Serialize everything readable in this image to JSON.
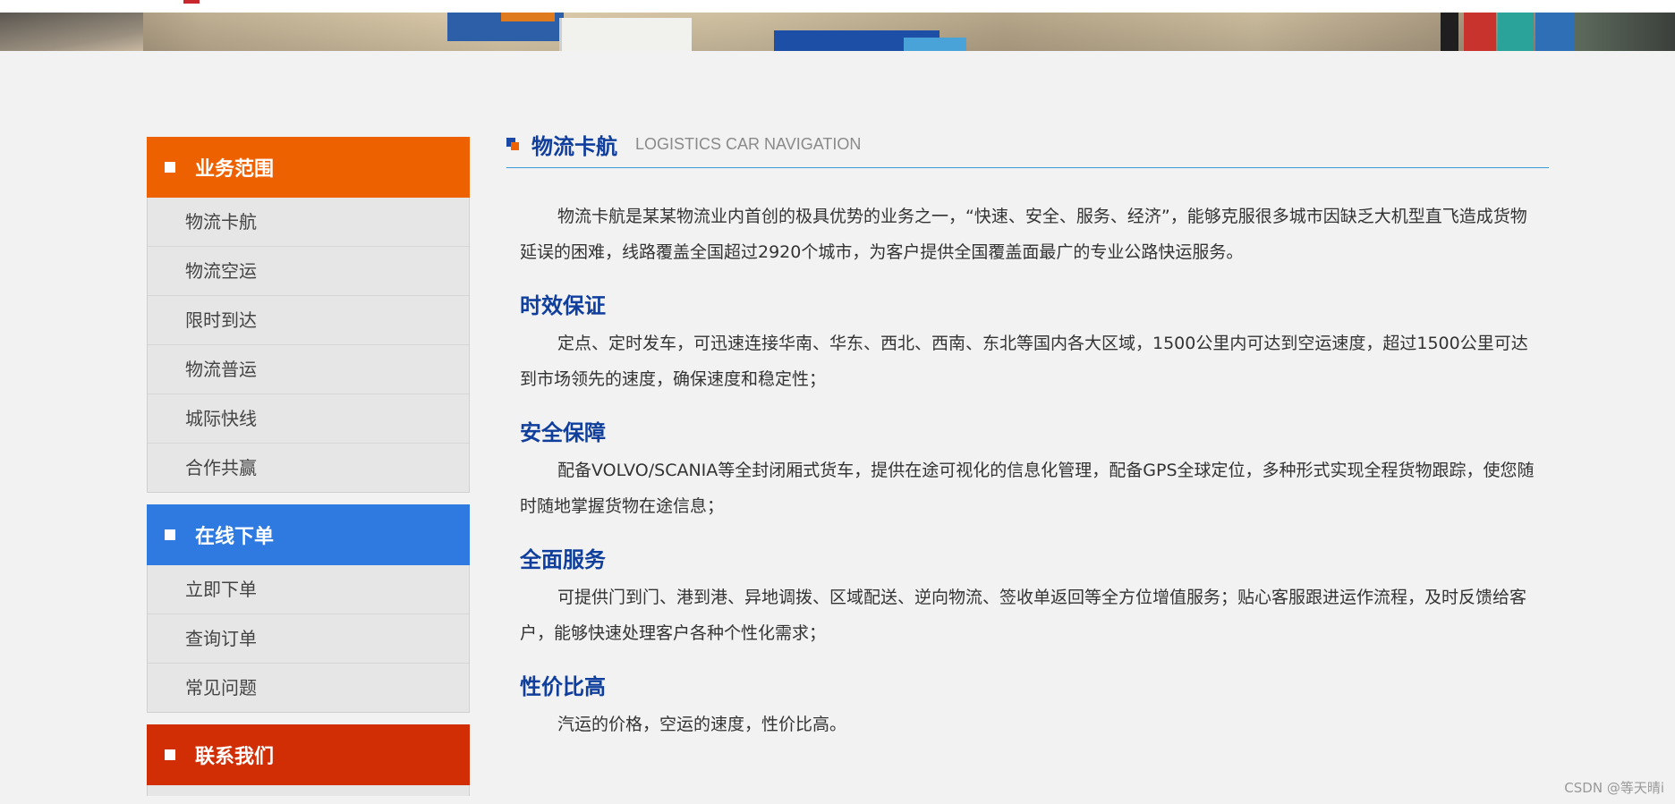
{
  "sidebar": {
    "groups": [
      {
        "title": "业务范围",
        "items": [
          "物流卡航",
          "物流空运",
          "限时到达",
          "物流普运",
          "城际快线",
          "合作共赢"
        ]
      },
      {
        "title": "在线下单",
        "items": [
          "立即下单",
          "查询订单",
          "常见问题"
        ]
      },
      {
        "title": "联系我们",
        "items": []
      }
    ]
  },
  "main": {
    "title_cn": "物流卡航",
    "title_en": "LOGISTICS CAR NAVIGATION",
    "intro": "物流卡航是某某物流业内首创的极具优势的业务之一，“快速、安全、服务、经济”，能够克服很多城市因缺乏大机型直飞造成货物延误的困难，线路覆盖全国超过2920个城市，为客户提供全国覆盖面最广的专业公路快运服务。",
    "sections": [
      {
        "title": "时效保证",
        "text": "定点、定时发车，可迅速连接华南、华东、西北、西南、东北等国内各大区域，1500公里内可达到空运速度，超过1500公里可达到市场领先的速度，确保速度和稳定性；"
      },
      {
        "title": "安全保障",
        "text": "配备VOLVO/SCANIA等全封闭厢式货车，提供在途可视化的信息化管理，配备GPS全球定位，多种形式实现全程货物跟踪，使您随时随地掌握货物在途信息；"
      },
      {
        "title": "全面服务",
        "text": "可提供门到门、港到港、异地调拨、区域配送、逆向物流、签收单返回等全方位增值服务；贴心客服跟进运作流程，及时反馈给客户，能够快速处理客户各种个性化需求；"
      },
      {
        "title": "性价比高",
        "text": "汽运的价格，空运的速度，性价比高。"
      }
    ]
  },
  "watermark": "CSDN @等天晴i",
  "colors": {
    "orange": "#ee6100",
    "blue": "#2e7ae0",
    "red": "#d22e06",
    "title_blue": "#0f3e9c",
    "divider": "#3b9ad8"
  }
}
